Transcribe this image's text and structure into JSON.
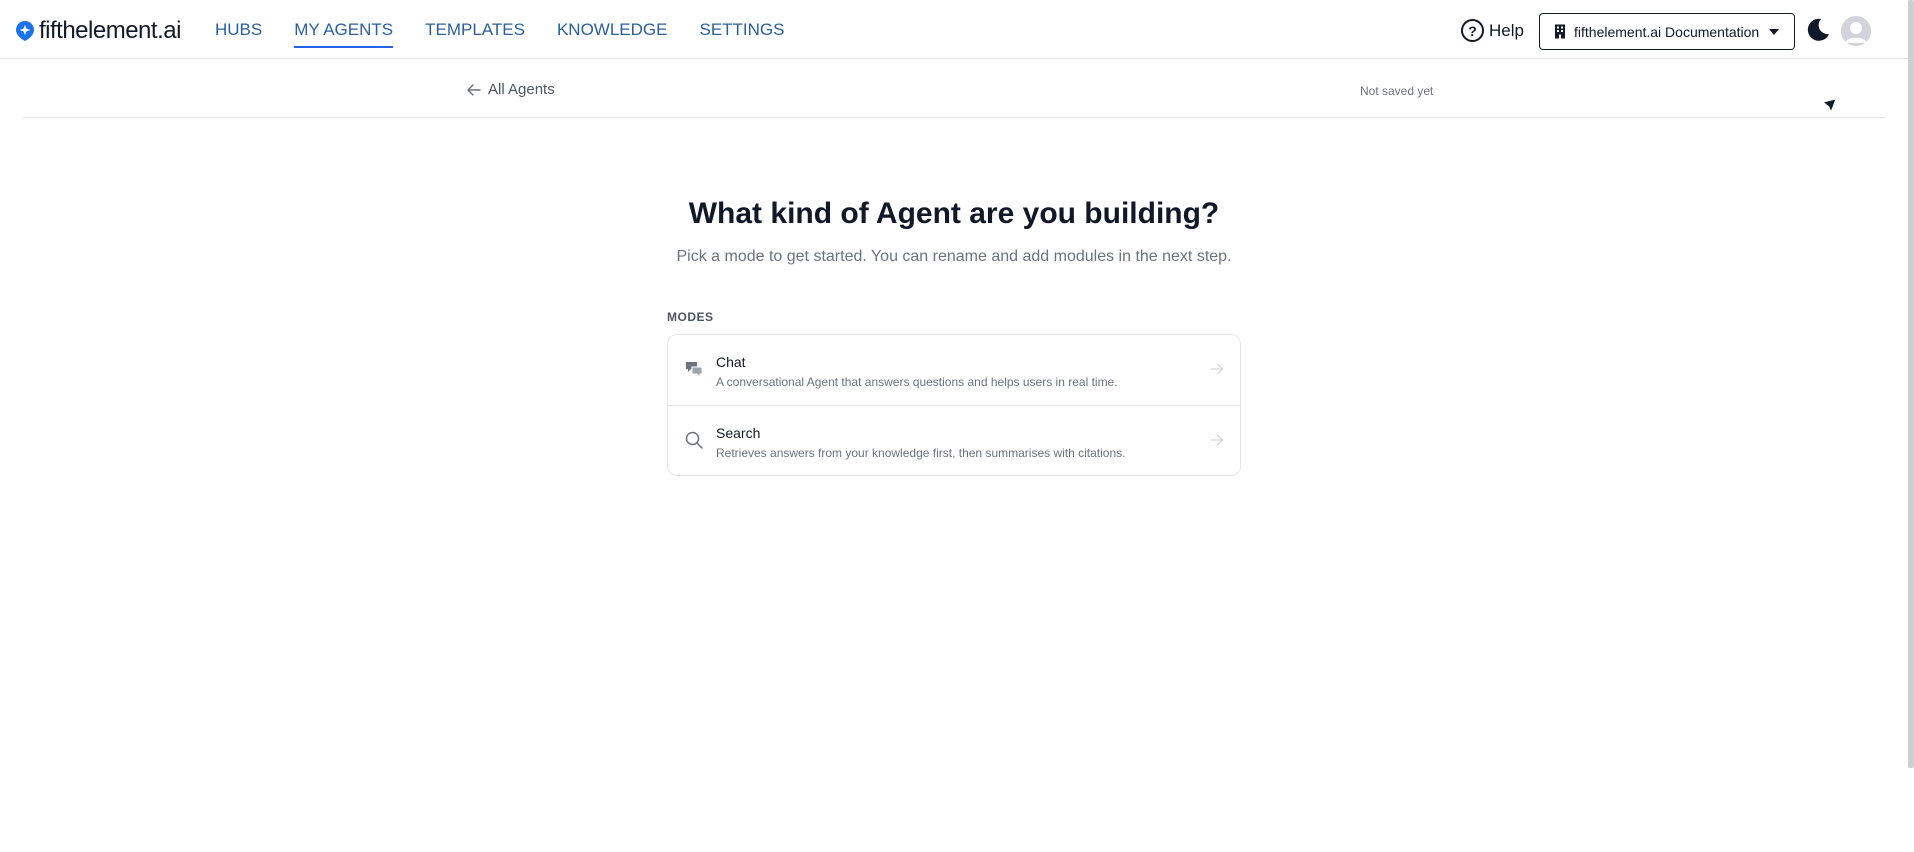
{
  "header": {
    "logo_text": "fifthelement.ai",
    "nav": [
      {
        "label": "HUBS",
        "active": false
      },
      {
        "label": "MY AGENTS",
        "active": true
      },
      {
        "label": "TEMPLATES",
        "active": false
      },
      {
        "label": "KNOWLEDGE",
        "active": false
      },
      {
        "label": "SETTINGS",
        "active": false
      }
    ],
    "help_label": "Help",
    "help_icon_glyph": "?",
    "workspace_label": "fifthelement.ai Documentation",
    "icons": {
      "logo": "logo-mark-icon",
      "help": "question-circle-icon",
      "workspace": "building-icon",
      "theme": "moon-icon",
      "avatar": "user-avatar-icon"
    }
  },
  "subbar": {
    "back_label": "All Agents",
    "save_status": "Not saved yet"
  },
  "main": {
    "title": "What kind of Agent are you building?",
    "subtitle": "Pick a mode to get started. You can rename and add modules in the next step.",
    "modes_label": "MODES",
    "modes": [
      {
        "name": "Chat",
        "description": "A conversational Agent that answers questions and helps users in real time.",
        "icon": "chat-bubbles-icon"
      },
      {
        "name": "Search",
        "description": "Retrieves answers from your knowledge first, then summarises with citations.",
        "icon": "search-icon"
      }
    ]
  },
  "colors": {
    "nav_link": "#2b5f9e",
    "nav_active_underline": "#2563eb",
    "brand": "#1a73e8",
    "text_primary": "#111827",
    "text_muted": "#6b7280",
    "border": "#e5e7eb"
  }
}
